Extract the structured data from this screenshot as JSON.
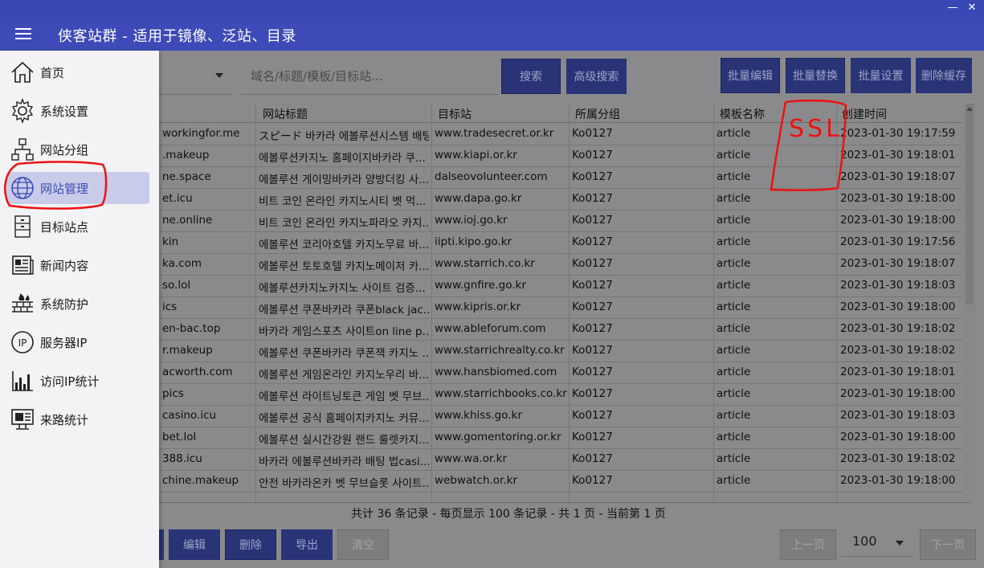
{
  "window": {
    "title": "侠客站群 - 适用于镜像、泛站、目录",
    "minimize_glyph": "—",
    "close_glyph": "✕"
  },
  "sidebar": {
    "items": [
      {
        "label": "首页",
        "icon": "home-icon",
        "active": false
      },
      {
        "label": "系统设置",
        "icon": "gear-icon",
        "active": false
      },
      {
        "label": "网站分组",
        "icon": "org-chart-icon",
        "active": false
      },
      {
        "label": "网站管理",
        "icon": "globe-icon",
        "active": true
      },
      {
        "label": "目标站点",
        "icon": "server-icon",
        "active": false
      },
      {
        "label": "新闻内容",
        "icon": "news-icon",
        "active": false
      },
      {
        "label": "系统防护",
        "icon": "firewall-icon",
        "active": false
      },
      {
        "label": "服务器IP",
        "icon": "ip-icon",
        "active": false
      },
      {
        "label": "访问IP统计",
        "icon": "stats-icon",
        "active": false
      },
      {
        "label": "来路统计",
        "icon": "monitor-stats-icon",
        "active": false
      }
    ]
  },
  "toolbar": {
    "search_placeholder": "域名/标题/模板/目标站...",
    "search_label": "搜索",
    "advanced_search_label": "高级搜索",
    "batch_edit_label": "批量编辑",
    "batch_replace_label": "批量替换",
    "batch_settings_label": "批量设置",
    "clear_cache_label": "删除缓存"
  },
  "table": {
    "columns": [
      "网站标题",
      "目标站",
      "所属分组",
      "模板名称",
      "创建时间"
    ],
    "rows": [
      {
        "domain": "workingfor.me",
        "title": "スピード 바카라 에볼루션시스템 배팅...",
        "target": "www.tradesecret.or.kr",
        "group": "Ko0127",
        "template": "article",
        "created": "2023-01-30 19:17:59"
      },
      {
        "domain": ".makeup",
        "title": "에볼루션카지노 홈페이지바카라 쿠...",
        "target": "www.kiapi.or.kr",
        "group": "Ko0127",
        "template": "article",
        "created": "2023-01-30 19:18:01"
      },
      {
        "domain": "ne.space",
        "title": "에볼루션 게이밍바카라 양방더킹 사...",
        "target": "dalseovolunteer.com",
        "group": "Ko0127",
        "template": "article",
        "created": "2023-01-30 19:18:07"
      },
      {
        "domain": "et.icu",
        "title": "비트 코인 온라인 카지노시티 벳 먹...",
        "target": "www.dapa.go.kr",
        "group": "Ko0127",
        "template": "article",
        "created": "2023-01-30 19:18:00"
      },
      {
        "domain": "ne.online",
        "title": "비트 코인 온라인 카지노파라오 카지...",
        "target": "www.ioj.go.kr",
        "group": "Ko0127",
        "template": "article",
        "created": "2023-01-30 19:18:00"
      },
      {
        "domain": "kin",
        "title": "에볼루션 코리아호텔 카지노무료 바...",
        "target": "iipti.kipo.go.kr",
        "group": "Ko0127",
        "template": "article",
        "created": "2023-01-30 19:17:56"
      },
      {
        "domain": "ka.com",
        "title": "에볼루션 토토호텔 카지노메이저 카...",
        "target": "www.starrich.co.kr",
        "group": "Ko0127",
        "template": "article",
        "created": "2023-01-30 19:18:07"
      },
      {
        "domain": "so.lol",
        "title": "에볼루션카지노카지노 사이트 검증...",
        "target": "www.gnfire.go.kr",
        "group": "Ko0127",
        "template": "article",
        "created": "2023-01-30 19:18:03"
      },
      {
        "domain": "ics",
        "title": "에볼루션 쿠폰바카라 쿠폰black jac...",
        "target": "www.kipris.or.kr",
        "group": "Ko0127",
        "template": "article",
        "created": "2023-01-30 19:18:00"
      },
      {
        "domain": "en-bac.top",
        "title": "바카라 게임스포츠 사이트on line p...",
        "target": "www.ableforum.com",
        "group": "Ko0127",
        "template": "article",
        "created": "2023-01-30 19:18:02"
      },
      {
        "domain": "r.makeup",
        "title": "에볼루션 쿠폰바카라 쿠폰잭 카지노 ...",
        "target": "www.starrichrealty.co.kr",
        "group": "Ko0127",
        "template": "article",
        "created": "2023-01-30 19:18:02"
      },
      {
        "domain": "acworth.com",
        "title": "에볼루션 게임온라인 카지노우리 바...",
        "target": "www.hansbiomed.com",
        "group": "Ko0127",
        "template": "article",
        "created": "2023-01-30 19:18:01"
      },
      {
        "domain": "pics",
        "title": "에볼루션 라이트닝토큰 게임 벳 무브...",
        "target": "www.starrichbooks.co.kr",
        "group": "Ko0127",
        "template": "article",
        "created": "2023-01-30 19:18:00"
      },
      {
        "domain": "casino.icu",
        "title": "에볼루션 공식 홈페이지카지노 커뮤...",
        "target": "www.khiss.go.kr",
        "group": "Ko0127",
        "template": "article",
        "created": "2023-01-30 19:18:03"
      },
      {
        "domain": "bet.lol",
        "title": "에볼루션 실시간강원 랜드 룰렛카지...",
        "target": "www.gomentoring.or.kr",
        "group": "Ko0127",
        "template": "article",
        "created": "2023-01-30 19:18:00"
      },
      {
        "domain": "388.icu",
        "title": "바카라 에볼루션바카라 배팅 법casi...",
        "target": "www.wa.or.kr",
        "group": "Ko0127",
        "template": "article",
        "created": "2023-01-30 19:18:02"
      },
      {
        "domain": "chine.makeup",
        "title": "안전 바카라온카 벳 무브슬롯 사이트...",
        "target": "webwatch.or.kr",
        "group": "Ko0127",
        "template": "article",
        "created": "2023-01-30 19:18:00"
      }
    ]
  },
  "footer": {
    "summary": "共计 36 条记录 - 每页显示 100 条记录 - 共 1 页 - 当前第 1 页",
    "edit_label": "编辑",
    "delete_label": "删除",
    "export_label": "导出",
    "clear_label": "清空",
    "prev_label": "上一页",
    "page_size": "100",
    "next_label": "下一页"
  },
  "annotation": {
    "text": "SSL",
    "color": "#ee1111"
  }
}
